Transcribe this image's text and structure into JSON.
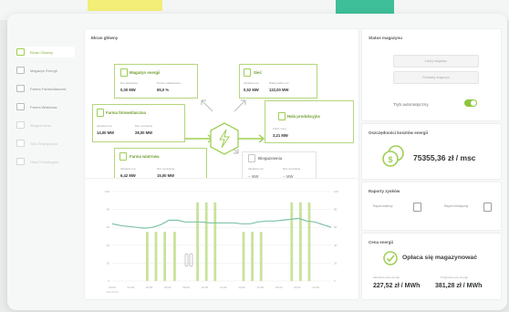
{
  "sidebar": {
    "items": [
      {
        "label": "Ekran Główny"
      },
      {
        "label": "Magazyn Energii"
      },
      {
        "label": "Farma Fotowoltaiczna"
      },
      {
        "label": "Farma Wiatrowa"
      },
      {
        "label": "Biogazownia"
      },
      {
        "label": "Sieć Zewnętrzna"
      },
      {
        "label": "Hala Produkcyjna"
      }
    ]
  },
  "main": {
    "title": "Ekran główny",
    "storage": {
      "title": "Magazyn energii",
      "stats": [
        {
          "label": "Moc ładowania",
          "value": "0,00 MW"
        },
        {
          "label": "Poziom naładowania",
          "value": "65,0 %"
        }
      ]
    },
    "grid": {
      "title": "Sieć",
      "stats": [
        {
          "label": "Aktualna moc",
          "value": "0,52 MW"
        },
        {
          "label": "Maksymalna moc",
          "value": "122,00 MW"
        }
      ]
    },
    "solar": {
      "title": "Farma fotowoltaiczna",
      "stats": [
        {
          "label": "Aktualna moc",
          "value": "14,00 MW"
        },
        {
          "label": "Moc nominalna",
          "value": "28,00 MW"
        }
      ]
    },
    "hall": {
      "title": "Hala produkcyjna",
      "stats": [
        {
          "label": "Pobór mocy",
          "value": "3,21 MW"
        }
      ]
    },
    "wind": {
      "title": "Farma wiatrowa",
      "stats": [
        {
          "label": "Aktualna moc",
          "value": "6,42 MW"
        },
        {
          "label": "Moc nominalna",
          "value": "15,00 MW"
        }
      ]
    },
    "biogas": {
      "title": "Biogazownia",
      "stats": [
        {
          "label": "Aktualna moc",
          "value": "-- MW"
        },
        {
          "label": "Moc nominalna",
          "value": "-- MW"
        }
      ]
    }
  },
  "status": {
    "title": "Status magazynu",
    "btn_charge": "Ładuj magazyn",
    "btn_discharge": "Rozładuj magazyn",
    "auto_label": "Tryb automatyczny"
  },
  "savings": {
    "title": "Oszczędności kosztów energii",
    "value": "75355,36 zł / msc"
  },
  "reports": {
    "title": "Raporty zysków",
    "items": [
      "Raport dzienny",
      "Raport miesięczny"
    ]
  },
  "price": {
    "title": "Cena energii",
    "message": "Opłaca się magazynować",
    "buy_label": "Aktualna cena energii",
    "buy_value": "227,52 zł / MWh",
    "sell_label": "Prognoza ceny energii",
    "sell_value": "381,28 zł / MWh"
  },
  "chart_data": {
    "type": "line",
    "x": [
      "00:00",
      "02:00",
      "04:00",
      "06:00",
      "08:00",
      "10:00",
      "12:00",
      "14:00",
      "16:00",
      "18:00",
      "20:00",
      "22:00"
    ],
    "x_sub": "2023-05-02",
    "series": [
      {
        "values": [
          64,
          62,
          61,
          60,
          59,
          60,
          63,
          68,
          68,
          66,
          66,
          66,
          65,
          65,
          65,
          65,
          64,
          64,
          66,
          67,
          67,
          68,
          69,
          70,
          67,
          66,
          63,
          60
        ]
      }
    ],
    "bars": [
      {
        "pos": 0.16,
        "height": 0.55
      },
      {
        "pos": 0.2,
        "height": 0.55
      },
      {
        "pos": 0.24,
        "height": 0.55
      },
      {
        "pos": 0.285,
        "height": 0.55
      },
      {
        "pos": 0.39,
        "height": 0.88
      },
      {
        "pos": 0.43,
        "height": 0.88
      },
      {
        "pos": 0.47,
        "height": 0.88
      },
      {
        "pos": 0.6,
        "height": 0.55
      },
      {
        "pos": 0.64,
        "height": 0.55
      },
      {
        "pos": 0.68,
        "height": 0.55
      },
      {
        "pos": 0.82,
        "height": 0.88
      },
      {
        "pos": 0.86,
        "height": 0.88
      },
      {
        "pos": 0.9,
        "height": 0.88
      }
    ],
    "ylim": [
      0,
      100
    ],
    "yticks": [
      100,
      80,
      60,
      40,
      20,
      0
    ],
    "color_line": "#7fc3a6",
    "color_bar": "#c9e39b"
  }
}
